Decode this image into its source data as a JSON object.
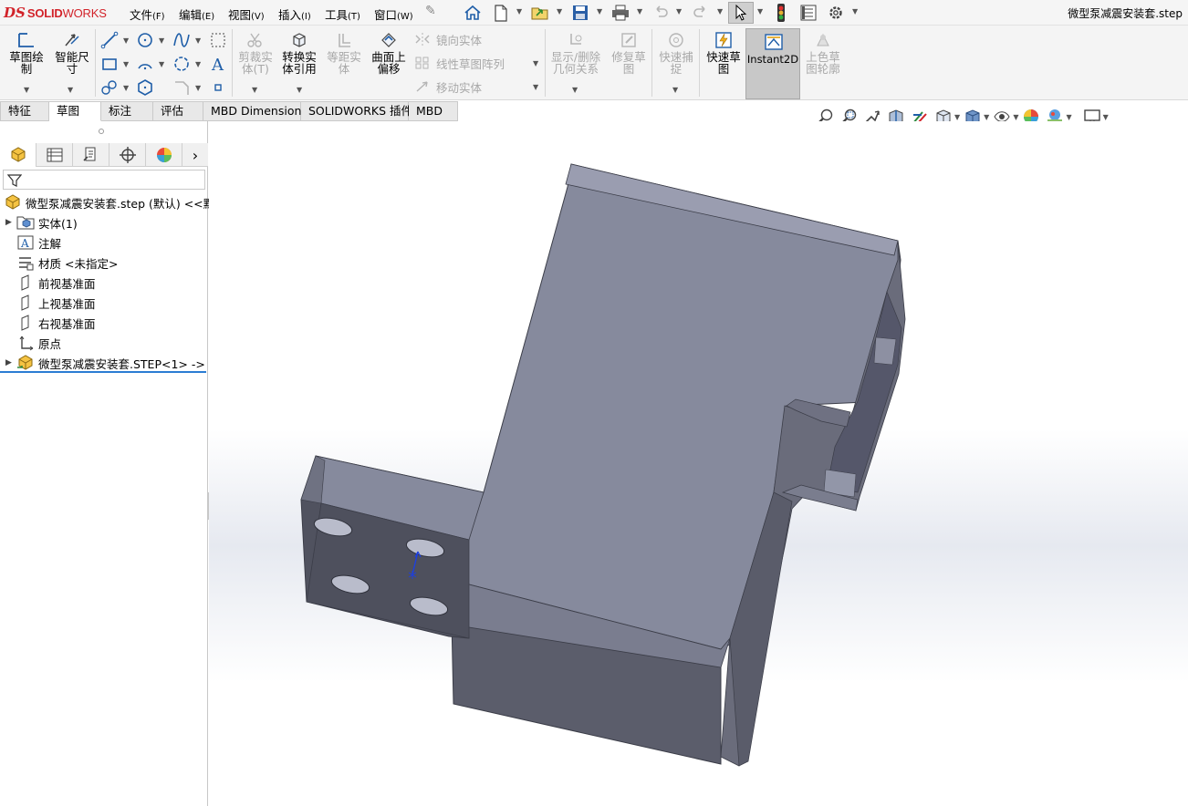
{
  "app": {
    "logo_prefix": "DS",
    "logo_bold": "SOLID",
    "logo_rest": "WORKS"
  },
  "menu": [
    {
      "label": "文件",
      "key": "(F)"
    },
    {
      "label": "编辑",
      "key": "(E)"
    },
    {
      "label": "视图",
      "key": "(V)"
    },
    {
      "label": "插入",
      "key": "(I)"
    },
    {
      "label": "工具",
      "key": "(T)"
    },
    {
      "label": "窗口",
      "key": "(W)"
    }
  ],
  "document_title": "微型泵减震安装套.step",
  "ribbon": {
    "sketch": "草图绘\n制",
    "smart_dimension": "智能尺\n寸",
    "trim_entities": "剪裁实\n体(T)",
    "convert_entities": "转换实\n体引用",
    "offset_entities": "等距实\n体",
    "offset_on_surface": "曲面上\n偏移",
    "mirror_entities": "镜向实体",
    "linear_pattern": "线性草图阵列",
    "move_entities": "移动实体",
    "display_relations": "显示/删除\n几何关系",
    "repair_sketch": "修复草\n图",
    "quick_snaps": "快速捕\n捉",
    "rapid_sketch": "快速草\n图",
    "instant2d": "Instant2D",
    "shaded_contours": "上色草\n图轮廓"
  },
  "tabs": [
    "特征",
    "草图",
    "标注",
    "评估",
    "MBD Dimensions",
    "SOLIDWORKS 插件",
    "MBD"
  ],
  "active_tab": "草图",
  "tree": {
    "root": "微型泵减震安装套.step (默认) <<默认",
    "items": [
      {
        "label": "实体(1)",
        "expandable": true,
        "icon": "solid-bodies-folder-icon"
      },
      {
        "label": "注解",
        "expandable": false,
        "icon": "annotations-icon"
      },
      {
        "label": "材质 <未指定>",
        "expandable": false,
        "icon": "material-icon"
      },
      {
        "label": "前视基准面",
        "expandable": false,
        "icon": "plane-icon"
      },
      {
        "label": "上视基准面",
        "expandable": false,
        "icon": "plane-icon"
      },
      {
        "label": "右视基准面",
        "expandable": false,
        "icon": "plane-icon"
      },
      {
        "label": "原点",
        "expandable": false,
        "icon": "origin-icon"
      },
      {
        "label": "微型泵减震安装套.STEP<1> ->",
        "expandable": true,
        "icon": "imported-part-icon"
      }
    ]
  },
  "colors": {
    "brand_red": "#d2232a",
    "part_top": "#878a9c",
    "part_side": "#5c5e6c",
    "part_dark": "#4a4c58",
    "selection_blue": "#2b7cd3"
  }
}
